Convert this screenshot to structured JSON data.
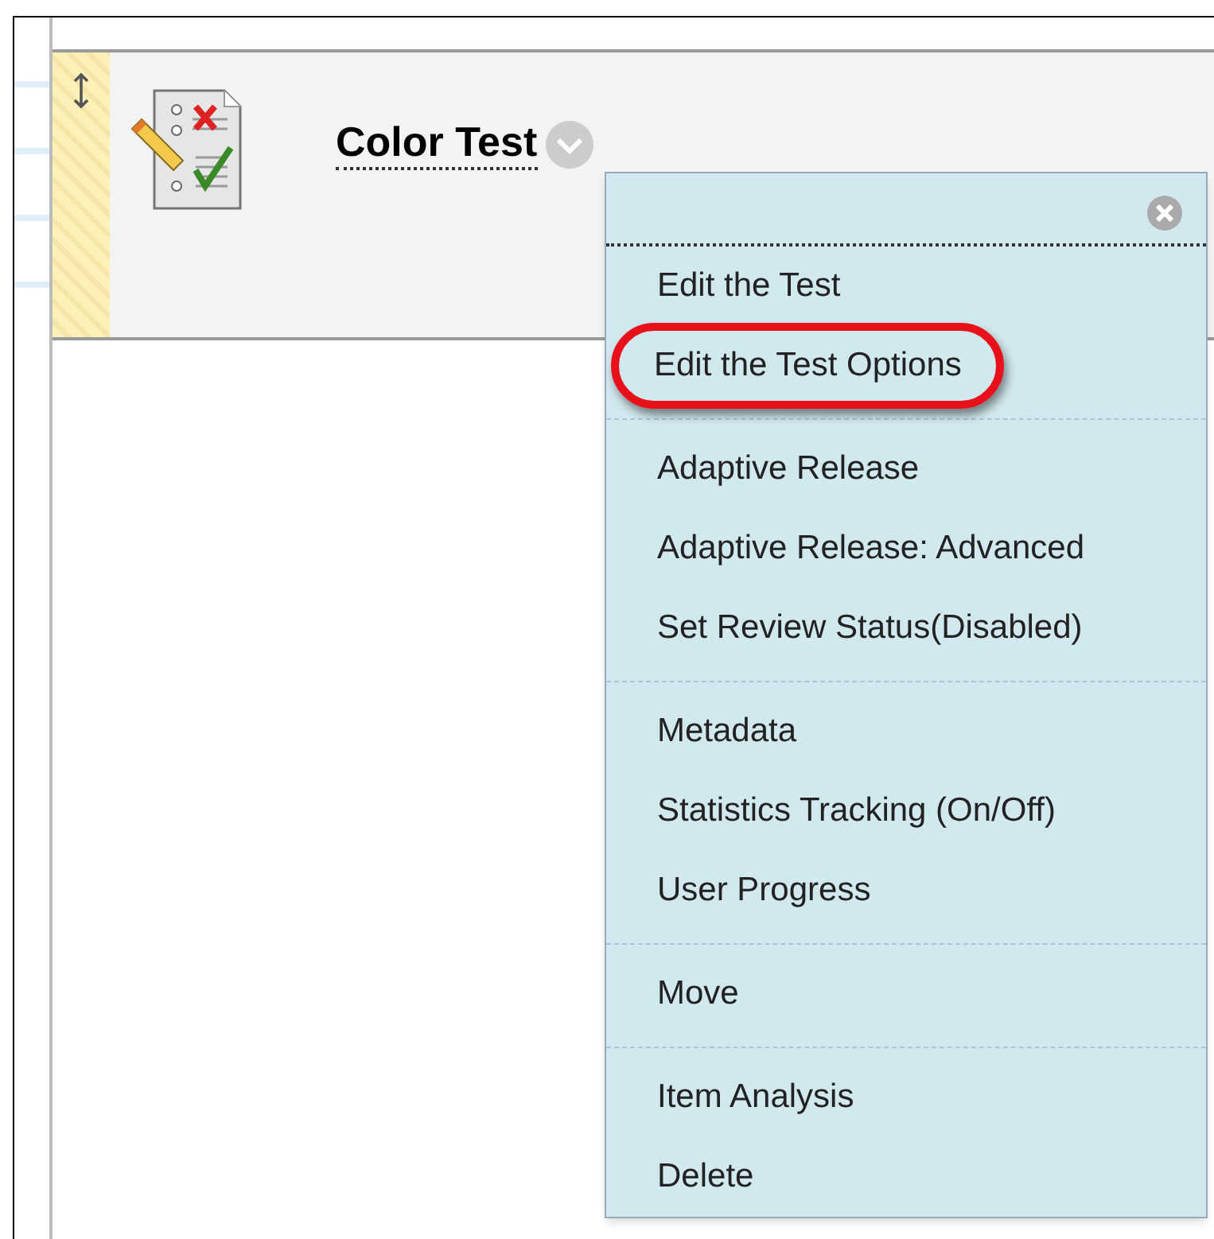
{
  "item": {
    "title": "Color Test"
  },
  "menu": {
    "groups": [
      {
        "items": [
          {
            "label": "Edit the Test",
            "highlighted": false
          },
          {
            "label": "Edit the Test Options",
            "highlighted": true
          }
        ]
      },
      {
        "items": [
          {
            "label": "Adaptive Release",
            "highlighted": false
          },
          {
            "label": "Adaptive Release: Advanced",
            "highlighted": false
          },
          {
            "label": "Set Review Status(Disabled)",
            "highlighted": false
          }
        ]
      },
      {
        "items": [
          {
            "label": "Metadata",
            "highlighted": false
          },
          {
            "label": "Statistics Tracking (On/Off)",
            "highlighted": false
          },
          {
            "label": "User Progress",
            "highlighted": false
          }
        ]
      },
      {
        "items": [
          {
            "label": "Move",
            "highlighted": false
          }
        ]
      },
      {
        "items": [
          {
            "label": "Item Analysis",
            "highlighted": false
          },
          {
            "label": "Delete",
            "highlighted": false
          }
        ]
      }
    ]
  }
}
